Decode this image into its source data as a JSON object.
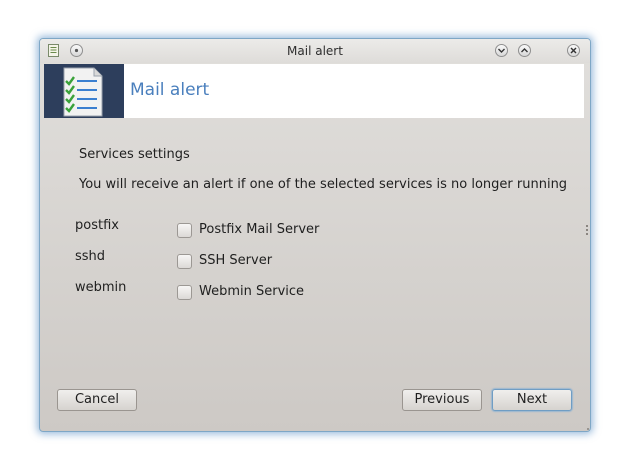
{
  "window": {
    "title": "Mail alert"
  },
  "banner": {
    "title": "Mail alert",
    "logo_icon": "checklist-document-icon"
  },
  "content": {
    "section_label": "Services settings",
    "description": "You will receive an alert if one of the selected services is no longer running",
    "services": [
      {
        "name": "postfix",
        "label": "Postfix Mail Server",
        "checked": false
      },
      {
        "name": "sshd",
        "label": "SSH Server",
        "checked": false
      },
      {
        "name": "webmin",
        "label": "Webmin Service",
        "checked": false
      }
    ]
  },
  "buttons": {
    "cancel": "Cancel",
    "previous": "Previous",
    "next": "Next"
  },
  "colors": {
    "banner_title": "#4a7fbd",
    "banner_logo_bg": "#2d3e5c",
    "window_glow": "#4682be"
  }
}
